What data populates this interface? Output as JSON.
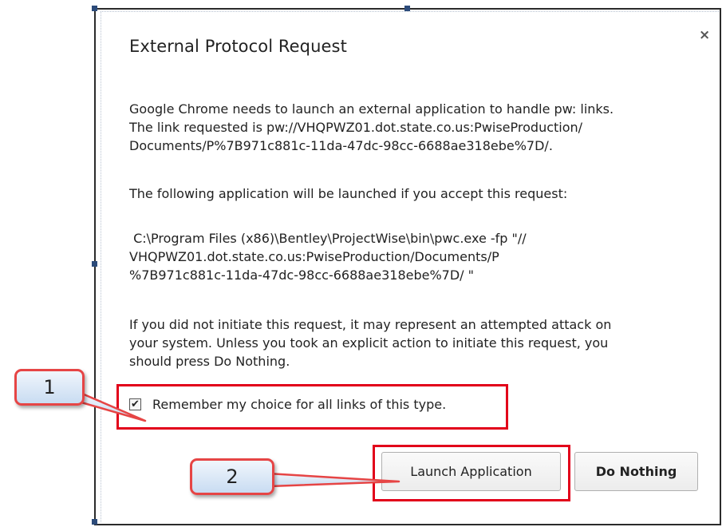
{
  "dialog": {
    "title": "External Protocol Request",
    "close_icon": "close-icon",
    "close_glyph": "×",
    "paragraph1": [
      "Google Chrome needs to launch an external application to handle pw: links.",
      "The link requested is pw://VHQPWZ01.dot.state.co.us:PwiseProduction/",
      "Documents/P%7B971c881c-11da-47dc-98cc-6688ae318ebe%7D/."
    ],
    "paragraph2": "The following application will be launched if you accept this request:",
    "paragraph3": [
      " C:\\Program Files (x86)\\Bentley\\ProjectWise\\bin\\pwc.exe -fp \"//",
      "VHQPWZ01.dot.state.co.us:PwiseProduction/Documents/P",
      "%7B971c881c-11da-47dc-98cc-6688ae318ebe%7D/ \""
    ],
    "paragraph4": [
      "If you did not initiate this request, it may represent an attempted attack on",
      "your system. Unless you took an explicit action to initiate this request, you",
      "should press Do Nothing."
    ],
    "checkbox": {
      "label": "Remember my choice for all links of this type.",
      "checked": true,
      "check_glyph": "✔"
    },
    "buttons": {
      "launch_label": "Launch Application",
      "nothing_label": "Do Nothing"
    }
  },
  "annotations": {
    "callout1": "1",
    "callout2": "2",
    "accent_color": "#e2001a"
  }
}
